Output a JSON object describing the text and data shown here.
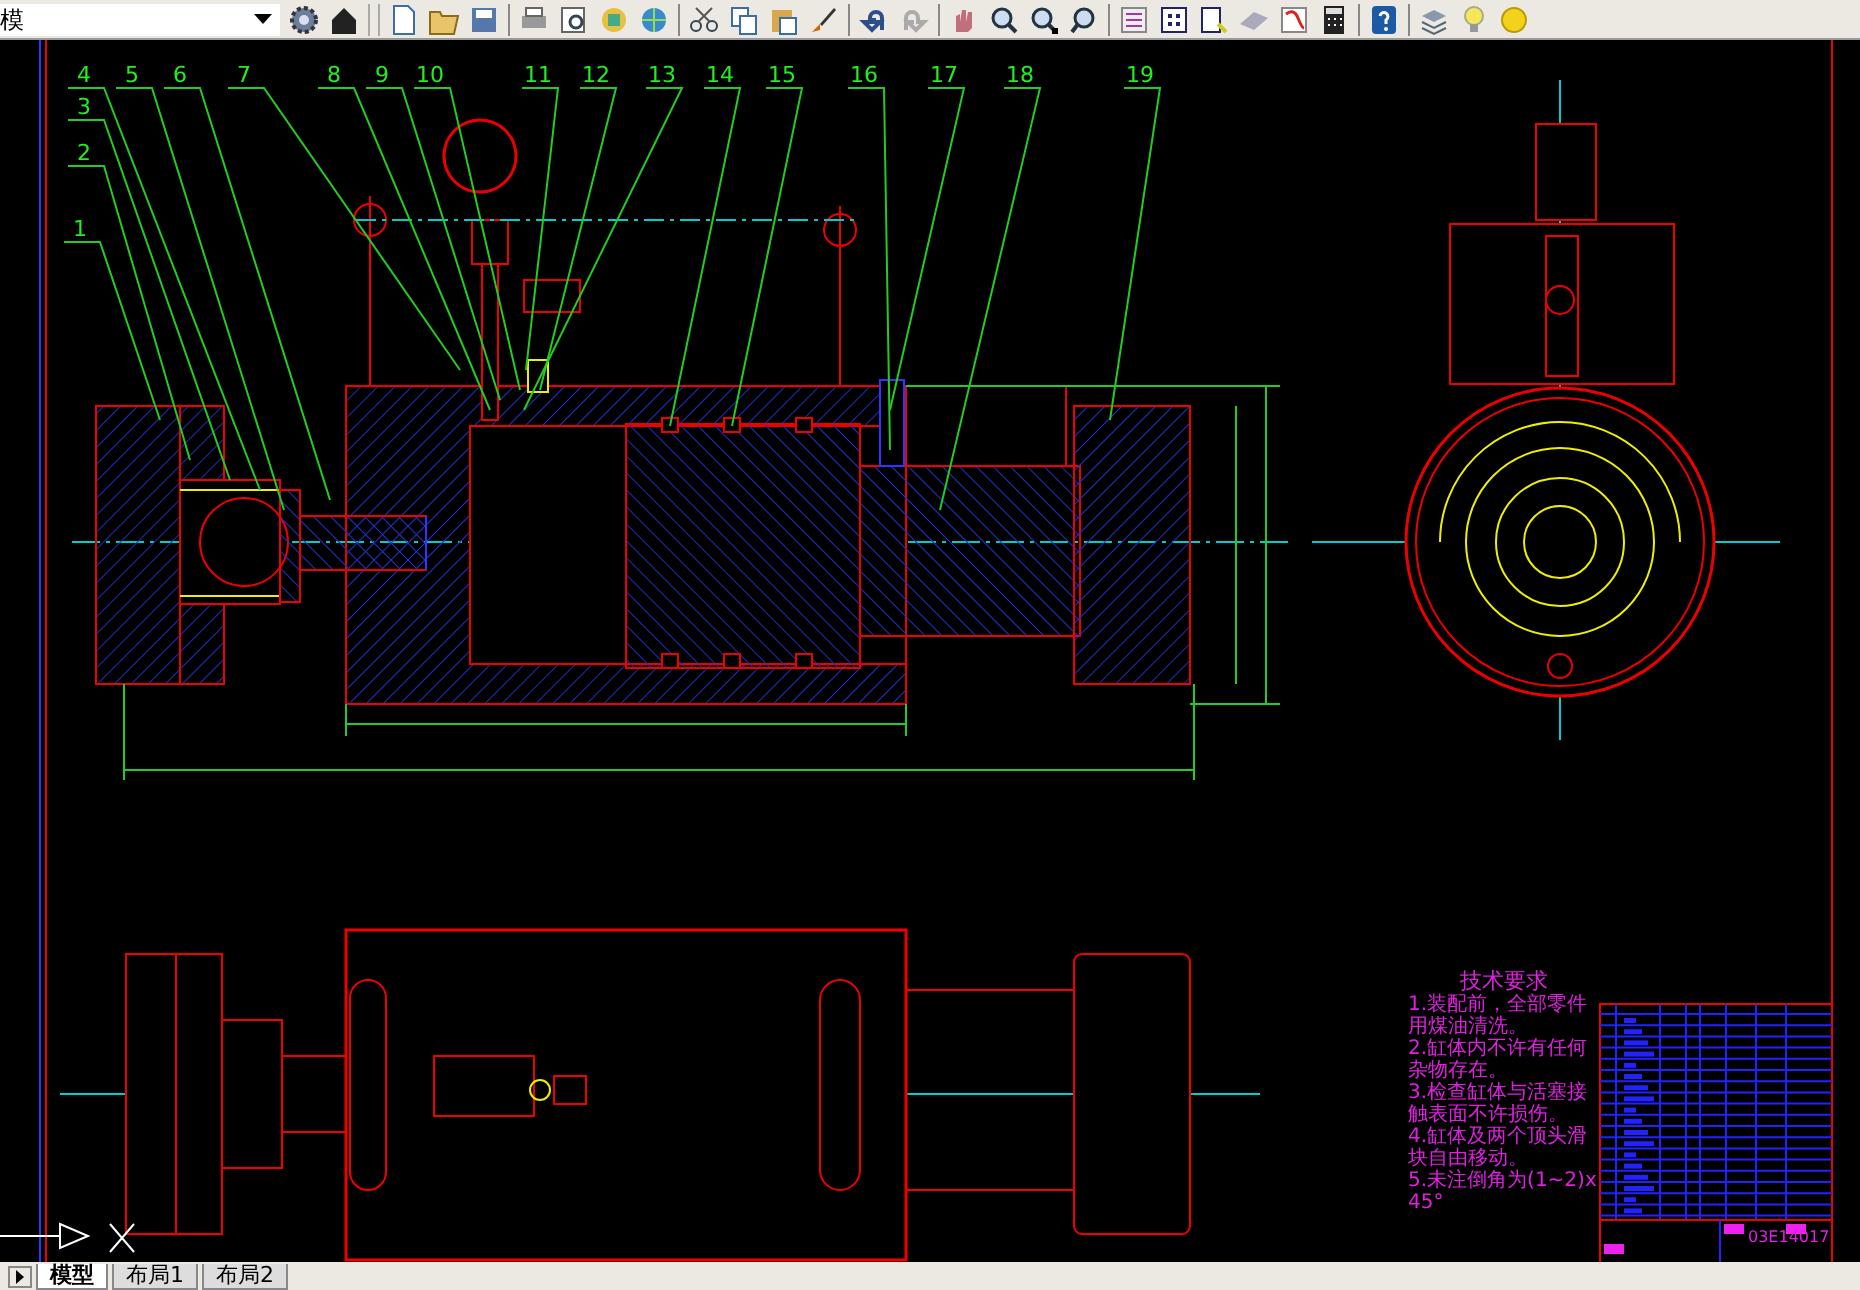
{
  "toolbar": {
    "workspace": "模"
  },
  "balloons": [
    "4",
    "5",
    "6",
    "7",
    "8",
    "9",
    "10",
    "11",
    "12",
    "13",
    "14",
    "15",
    "16",
    "17",
    "18",
    "19",
    "3",
    "2",
    "1"
  ],
  "tech_requirements": {
    "title": "技术要求",
    "lines": [
      "1.装配前，全部零件用煤油清洗。",
      "2.缸体内不许有任何杂物存在。",
      "3.检查缸体与活塞接触表面不许损伤。",
      "4.缸体及两个顶头滑块自由移动。",
      "5.未注倒角为(1~2)x45°"
    ]
  },
  "title_block": {
    "drawing_number": "03E14017"
  },
  "layout_tabs": [
    {
      "label": "模型",
      "selected": true
    },
    {
      "label": "布局1",
      "selected": false
    },
    {
      "label": "布局2",
      "selected": false
    }
  ]
}
